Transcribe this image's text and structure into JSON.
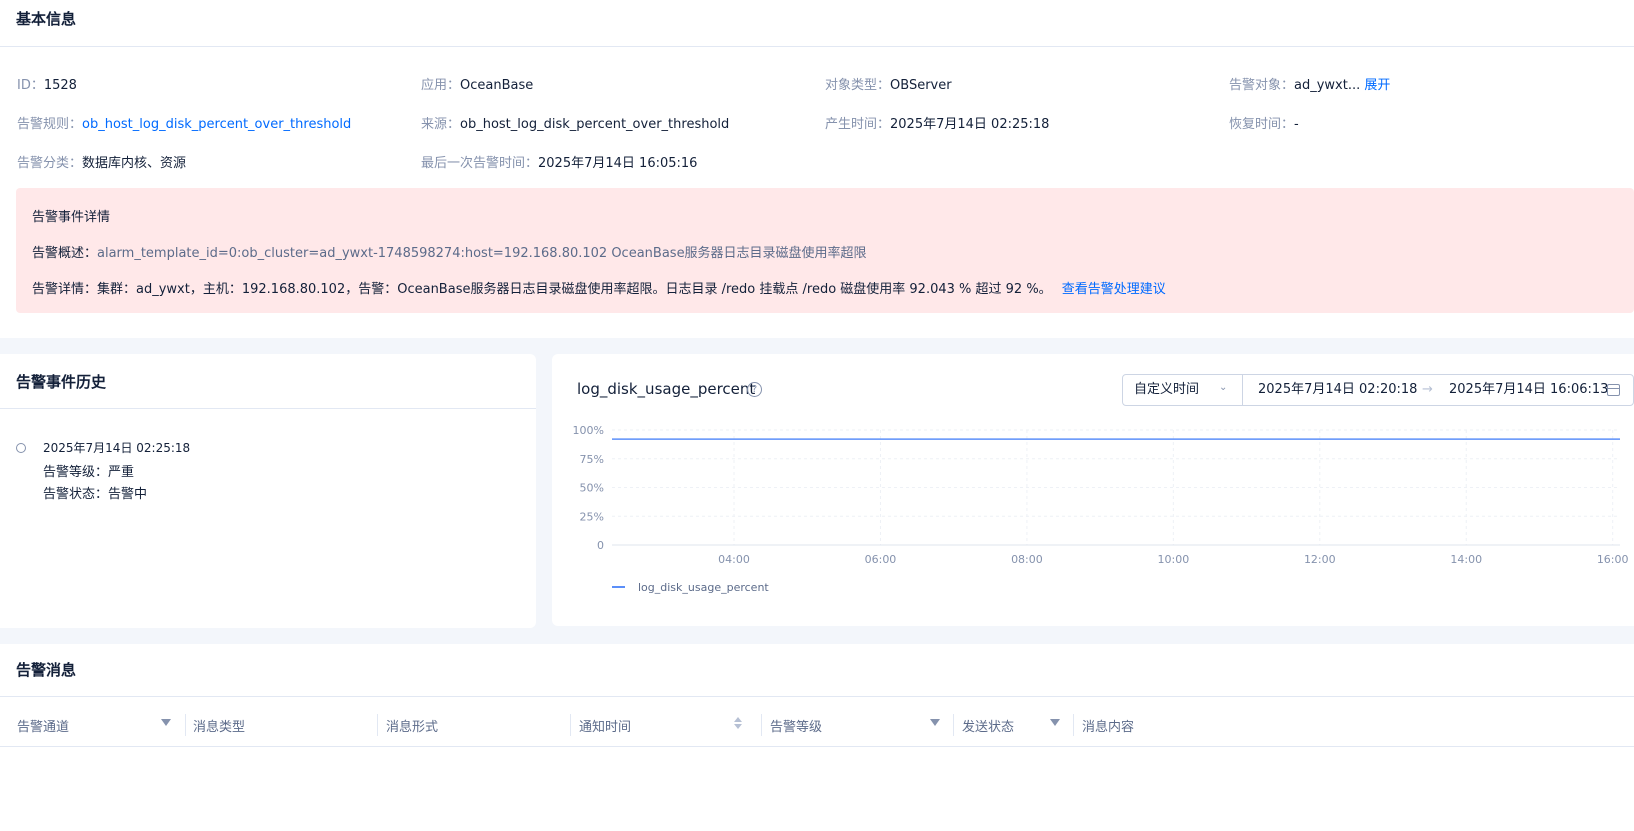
{
  "basic_info": {
    "title": "基本信息",
    "id_label": "ID：",
    "id_value": "1528",
    "app_label": "应用：",
    "app_value": "OceanBase",
    "object_type_label": "对象类型：",
    "object_type_value": "OBServer",
    "target_label": "告警对象：",
    "target_value": "ad_ywxt...",
    "target_expand": "展开",
    "rule_label": "告警规则：",
    "rule_value": "ob_host_log_disk_percent_over_threshold",
    "source_label": "来源：",
    "source_value": "ob_host_log_disk_percent_over_threshold",
    "created_label": "产生时间：",
    "created_value": "2025年7月14日 02:25:18",
    "recovered_label": "恢复时间：",
    "recovered_value": "-",
    "category_label": "告警分类：",
    "category_value": "数据库内核、资源",
    "last_alert_label": "最后一次告警时间：",
    "last_alert_value": "2025年7月14日 16:05:16"
  },
  "event_detail": {
    "title": "告警事件详情",
    "summary_label": "告警概述：",
    "summary_value": "alarm_template_id=0:ob_cluster=ad_ywxt-1748598274:host=192.168.80.102 OceanBase服务器日志目录磁盘使用率超限",
    "detail_label": "告警详情：",
    "detail_value": "集群：ad_ywxt，主机：192.168.80.102，告警：OceanBase服务器日志目录磁盘使用率超限。日志目录 /redo 挂载点 /redo 磁盘使用率 92.043 % 超过 92 %。",
    "suggestion_link": "查看告警处理建议"
  },
  "history": {
    "title": "告警事件历史",
    "items": [
      {
        "time": "2025年7月14日 02:25:18",
        "level_label": "告警等级：",
        "level": "严重",
        "status_label": "告警状态：",
        "status": "告警中"
      }
    ]
  },
  "metric": {
    "name": "log_disk_usage_percent",
    "help_icon": "question-circle-icon",
    "range_select": "自定义时间",
    "start": "2025年7月14日 02:20:18",
    "arrow": "→",
    "end": "2025年7月14日 16:06:13",
    "calendar_icon": "calendar-icon"
  },
  "chart_data": {
    "type": "line",
    "title": "",
    "xlabel": "",
    "ylabel": "",
    "x_tick_labels": [
      "04:00",
      "06:00",
      "08:00",
      "10:00",
      "12:00",
      "14:00",
      "16:00"
    ],
    "y_tick_labels": [
      "0",
      "25%",
      "50%",
      "75%",
      "100%"
    ],
    "y_ticks": [
      0,
      25,
      50,
      75,
      100
    ],
    "ylim": [
      0,
      100
    ],
    "x_range": [
      "02:20",
      "16:06"
    ],
    "grid": true,
    "legend_position": "bottom-left",
    "series": [
      {
        "name": "log_disk_usage_percent",
        "color": "#5b8ff9",
        "x": [
          "02:20",
          "16:06"
        ],
        "values": [
          92.04,
          92.04
        ]
      }
    ]
  },
  "messages": {
    "title": "告警消息",
    "columns": [
      "告警通道",
      "消息类型",
      "消息形式",
      "通知时间",
      "告警等级",
      "发送状态",
      "消息内容"
    ],
    "rows": []
  }
}
